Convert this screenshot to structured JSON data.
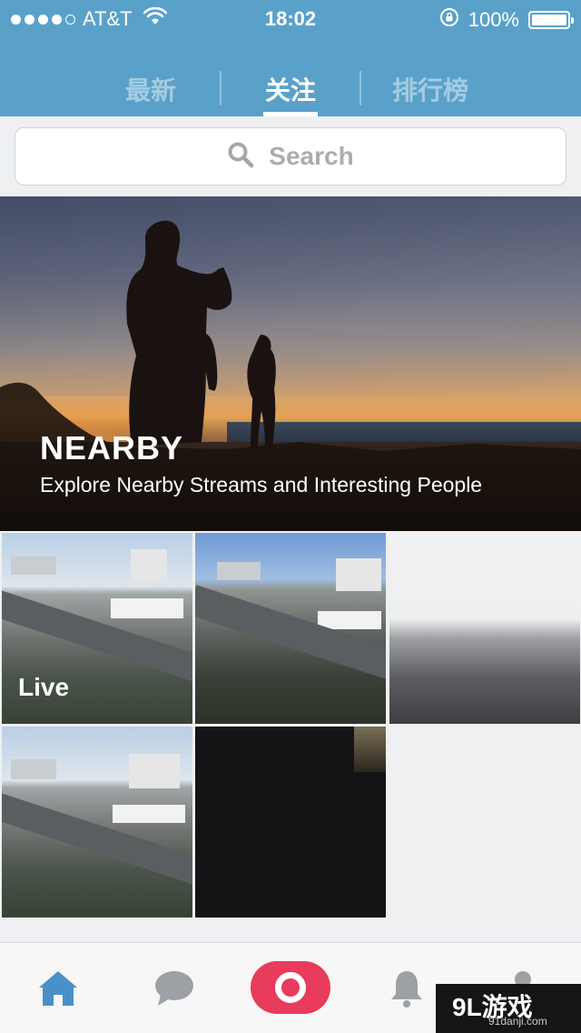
{
  "status_bar": {
    "carrier": "AT&T",
    "time": "18:02",
    "battery": "100%"
  },
  "tabs": [
    {
      "label": "最新",
      "active": false
    },
    {
      "label": "关注",
      "active": true
    },
    {
      "label": "排行榜",
      "active": false
    }
  ],
  "search": {
    "placeholder": "Search"
  },
  "banner": {
    "title": "NEARBY",
    "subtitle": "Explore Nearby Streams and Interesting People"
  },
  "streams": [
    {
      "label": "Live"
    }
  ],
  "bottom_tabs": [
    {
      "icon": "home-icon"
    },
    {
      "icon": "chat-icon"
    },
    {
      "icon": "record-icon"
    },
    {
      "icon": "bell-icon"
    },
    {
      "icon": "profile-icon"
    }
  ],
  "watermark": {
    "main": "9L游戏",
    "sub": "91danji.com"
  },
  "colors": {
    "header": "#5aa1c9",
    "record": "#e93b5b",
    "home_active": "#4a90c8",
    "inactive_icon": "#9da1a6"
  }
}
